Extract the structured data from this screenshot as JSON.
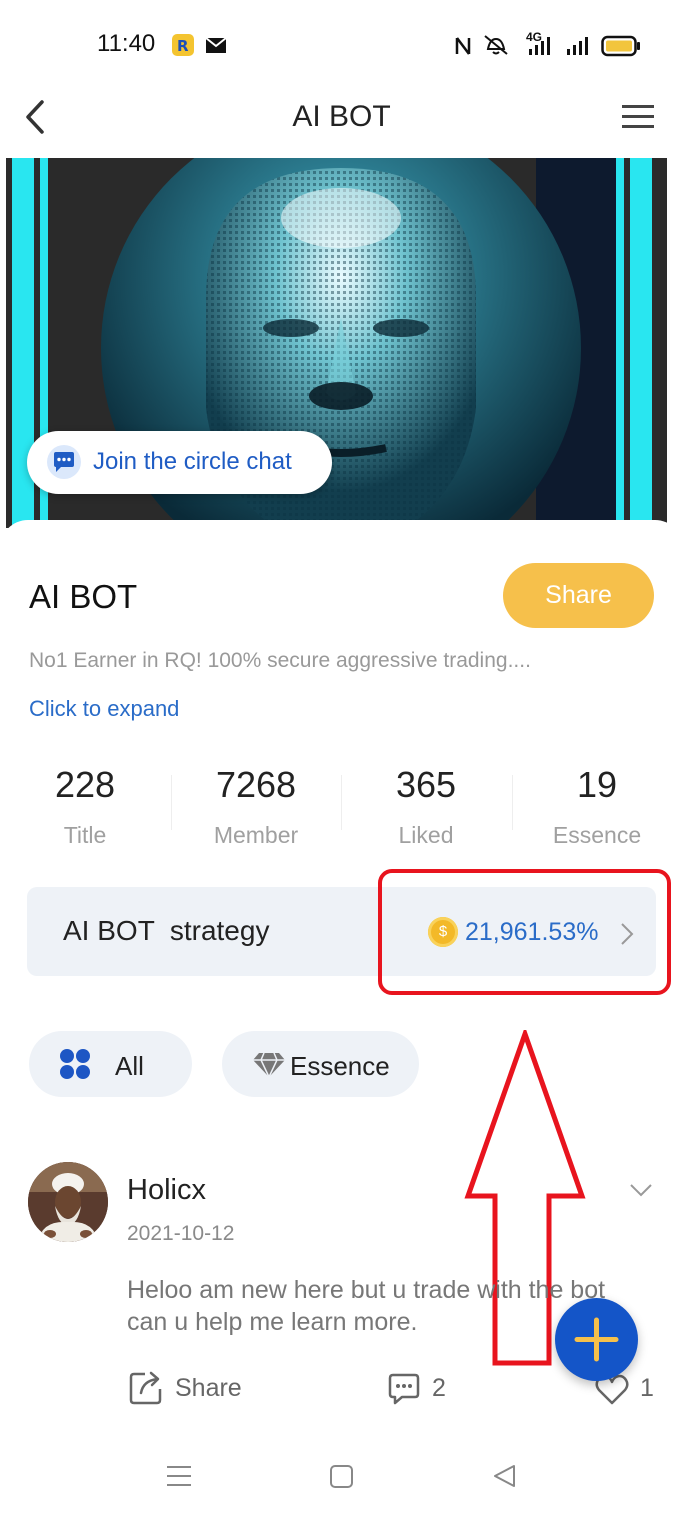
{
  "status_bar": {
    "time": "11:40",
    "network": "4G",
    "icons": [
      "app-r-icon",
      "mail-icon",
      "nfc-icon",
      "mute-icon",
      "signal-icon",
      "signal-icon",
      "battery-icon"
    ]
  },
  "header": {
    "title": "AI BOT",
    "back_icon": "back-arrow-icon",
    "menu_icon": "hamburger-menu-icon"
  },
  "banner": {
    "image": "robot-face-image",
    "join_chat_label": "Join the circle chat",
    "join_chat_icon": "chat-bubble-icon"
  },
  "circle": {
    "name": "AI BOT",
    "share_label": "Share",
    "description": "No1 Earner in RQ! 100% secure aggressive trading....",
    "expand_label": "Click to expand",
    "stats": [
      {
        "value": "228",
        "label": "Title"
      },
      {
        "value": "7268",
        "label": "Member"
      },
      {
        "value": "365",
        "label": "Liked"
      },
      {
        "value": "19",
        "label": "Essence"
      }
    ]
  },
  "strategy": {
    "label": "AI BOT  strategy",
    "value": "21,961.53%",
    "coin_symbol": "$"
  },
  "filters": [
    {
      "label": "All",
      "icon": "grid-icon"
    },
    {
      "label": "Essence",
      "icon": "diamond-icon"
    }
  ],
  "post": {
    "author": "Holicx",
    "date": "2021-10-12",
    "body": "Heloo am new here but u trade with the bot can u help me learn more.",
    "share_label": "Share",
    "comment_count": "2",
    "like_count": "1"
  },
  "colors": {
    "accent_blue": "#2a6cc8",
    "share_yellow": "#f6c04b",
    "annotation_red": "#e8141e",
    "fab_blue": "#1455c8"
  }
}
